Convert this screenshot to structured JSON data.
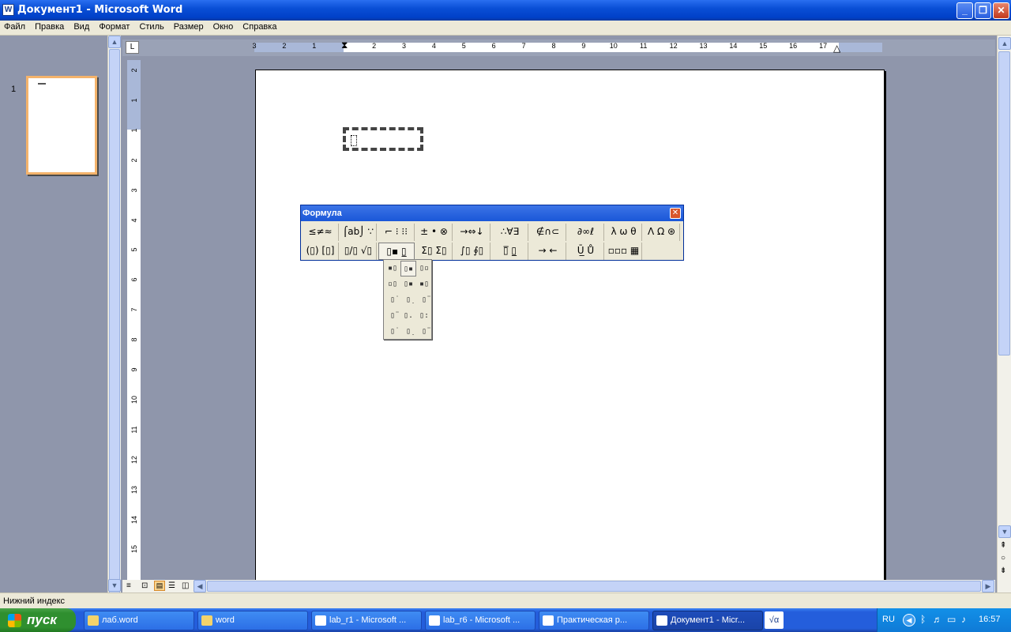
{
  "window": {
    "title": "Документ1 - Microsoft Word"
  },
  "menu": [
    "Файл",
    "Правка",
    "Вид",
    "Формат",
    "Стиль",
    "Размер",
    "Окно",
    "Справка"
  ],
  "thumbnail": {
    "page_number": "1"
  },
  "ruler": {
    "corner": "L",
    "h_labels": [
      "3",
      "2",
      "1",
      "1",
      "2",
      "3",
      "4",
      "5",
      "6",
      "7",
      "8",
      "9",
      "10",
      "11",
      "12",
      "13",
      "14",
      "15",
      "16",
      "17"
    ],
    "v_labels": [
      "2",
      "1",
      "1",
      "2",
      "3",
      "4",
      "5",
      "6",
      "7",
      "8",
      "9",
      "10",
      "11",
      "12",
      "13",
      "14",
      "15"
    ]
  },
  "formula_toolbar": {
    "title": "Формула",
    "row1": [
      "≤≠≈",
      "⌠ab⌡ ∵",
      "⌐ ⁝ ⁝⁝",
      "± • ⊗",
      "→⇔↓",
      "∴∀∃",
      "∉∩⊂",
      "∂∞ℓ",
      "λ ω θ",
      "Λ Ω ⊛"
    ],
    "row2": [
      "(▯) [▯]",
      "▯/▯ √▯",
      "▯▪ ▯̲",
      "Σ▯ Σ▯",
      "∫▯ ∮▯",
      "▯̅ ▯̲",
      "→ ←",
      "Ū̲ Ů",
      "▫▫▫ ▦"
    ]
  },
  "palette": {
    "cells": [
      "▪▯",
      "▯▪",
      "▯▫",
      "▫▯",
      "▯▪",
      "▪▯",
      "▯̇",
      "▯̣",
      "▯̈",
      "▯̈",
      "▯.",
      "▯:",
      "▯̇",
      "▯̣",
      "▯̈"
    ]
  },
  "status": {
    "text": "Нижний индекс"
  },
  "taskbar": {
    "start_label": "пуск",
    "tasks": [
      {
        "label": "лаб.word",
        "icon_color": "#f3d36b"
      },
      {
        "label": "word",
        "icon_color": "#f3d36b"
      },
      {
        "label": "lab_r1 - Microsoft ...",
        "icon_color": "#ffffff"
      },
      {
        "label": "lab_r6 - Microsoft ...",
        "icon_color": "#ffffff"
      },
      {
        "label": "Практическая р...",
        "icon_color": "#ffffff"
      },
      {
        "label": "Документ1 - Micr...",
        "icon_color": "#ffffff"
      }
    ],
    "equation_icon": "√α",
    "lang": "RU",
    "clock": "16:57"
  },
  "colors": {
    "accent": "#245edc",
    "page_border": "#f4b36b"
  }
}
